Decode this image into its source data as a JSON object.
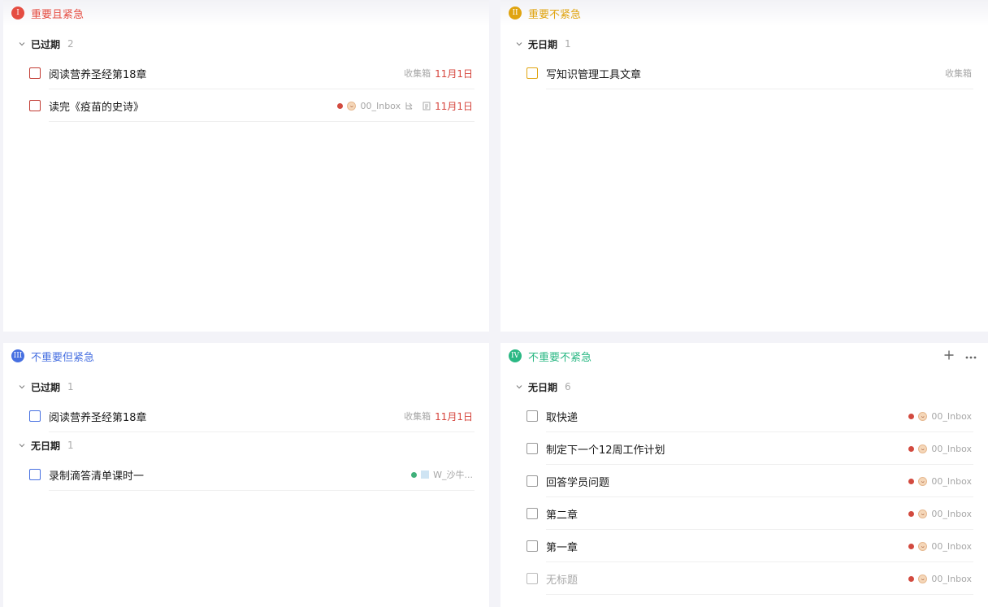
{
  "colors": {
    "q1": "#e54d42",
    "q2": "#e0a410",
    "q3": "#4770e1",
    "q4": "#2bb884",
    "due": "#d6453d",
    "dot_red": "#d24a3f",
    "dot_green": "#3fb07a"
  },
  "quadrants": [
    {
      "badge": "I",
      "title": "重要且紧急",
      "sections": [
        {
          "title": "已过期",
          "count": "2",
          "tasks": [
            {
              "title": "阅读营养圣经第18章",
              "list": "收集箱",
              "date": "11月1日"
            },
            {
              "title": "读完《疫苗的史诗》",
              "list": "00_Inbox",
              "date": "11月1日"
            }
          ]
        }
      ]
    },
    {
      "badge": "II",
      "title": "重要不紧急",
      "sections": [
        {
          "title": "无日期",
          "count": "1",
          "tasks": [
            {
              "title": "写知识管理工具文章",
              "list": "收集箱"
            }
          ]
        }
      ]
    },
    {
      "badge": "III",
      "title": "不重要但紧急",
      "sections": [
        {
          "title": "已过期",
          "count": "1",
          "tasks": [
            {
              "title": "阅读营养圣经第18章",
              "list": "收集箱",
              "date": "11月1日"
            }
          ]
        },
        {
          "title": "无日期",
          "count": "1",
          "tasks": [
            {
              "title": "录制滴答清单课时一",
              "list": "W_沙牛..."
            }
          ]
        }
      ]
    },
    {
      "badge": "IV",
      "title": "不重要不紧急",
      "sections": [
        {
          "title": "无日期",
          "count": "6",
          "tasks": [
            {
              "title": "取快递",
              "list": "00_Inbox"
            },
            {
              "title": "制定下一个12周工作计划",
              "list": "00_Inbox"
            },
            {
              "title": "回答学员问题",
              "list": "00_Inbox"
            },
            {
              "title": "第二章",
              "list": "00_Inbox"
            },
            {
              "title": "第一章",
              "list": "00_Inbox"
            },
            {
              "title": "无标题",
              "list": "00_Inbox"
            }
          ]
        }
      ]
    }
  ],
  "icons": {
    "section_toggle": "chevron-down-icon",
    "add": "plus-icon",
    "more": "more-icon",
    "avatar": "face-icon",
    "subtask": "subtask-icon",
    "note": "note-icon",
    "list_doc": "doc-icon"
  }
}
